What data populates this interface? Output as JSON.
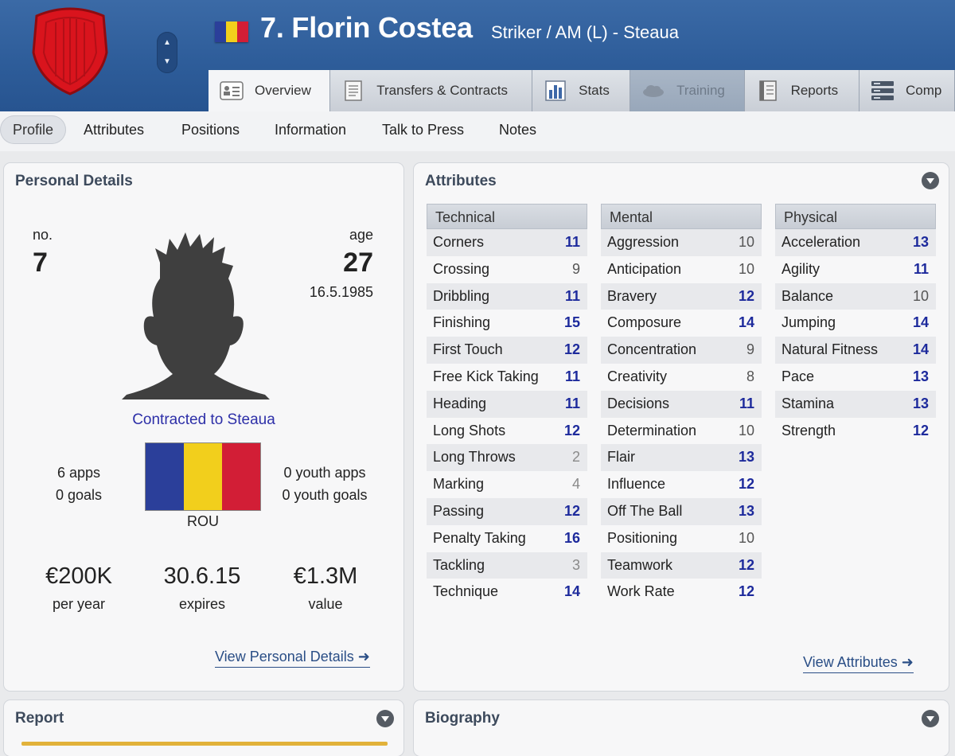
{
  "header": {
    "player_number_name": "7. Florin Costea",
    "subtitle": "Striker / AM (L) - Steaua",
    "flag_colors": [
      "#2b3f9a",
      "#f2cf1c",
      "#d21e36"
    ]
  },
  "main_tabs": [
    {
      "label": "Overview",
      "icon": "overview-icon",
      "state": "active"
    },
    {
      "label": "Transfers & Contracts",
      "icon": "document-icon",
      "state": "normal"
    },
    {
      "label": "Stats",
      "icon": "bar-chart-icon",
      "state": "normal"
    },
    {
      "label": "Training",
      "icon": "cloud-icon",
      "state": "disabled"
    },
    {
      "label": "Reports",
      "icon": "report-icon",
      "state": "normal"
    },
    {
      "label": "Comp",
      "icon": "compare-icon",
      "state": "normal"
    }
  ],
  "sub_nav": [
    "Profile",
    "Attributes",
    "Positions",
    "Information",
    "Talk to Press",
    "Notes"
  ],
  "personal_details": {
    "title": "Personal Details",
    "no_label": "no.",
    "no_value": "7",
    "age_label": "age",
    "age_value": "27",
    "dob": "16.5.1985",
    "contract_text": "Contracted to Steaua",
    "apps": "6 apps",
    "goals": "0 goals",
    "youth_apps": "0 youth apps",
    "youth_goals": "0 youth goals",
    "nation_code": "ROU",
    "wage_value": "€200K",
    "wage_label": "per year",
    "expires_value": "30.6.15",
    "expires_label": "expires",
    "value_value": "€1.3M",
    "value_label": "value",
    "view_link": "View Personal Details"
  },
  "attributes": {
    "title": "Attributes",
    "view_link": "View Attributes",
    "columns": [
      {
        "header": "Technical",
        "rows": [
          {
            "name": "Corners",
            "value": 11
          },
          {
            "name": "Crossing",
            "value": 9
          },
          {
            "name": "Dribbling",
            "value": 11
          },
          {
            "name": "Finishing",
            "value": 15
          },
          {
            "name": "First Touch",
            "value": 12
          },
          {
            "name": "Free Kick Taking",
            "value": 11
          },
          {
            "name": "Heading",
            "value": 11
          },
          {
            "name": "Long Shots",
            "value": 12
          },
          {
            "name": "Long Throws",
            "value": 2
          },
          {
            "name": "Marking",
            "value": 4
          },
          {
            "name": "Passing",
            "value": 12
          },
          {
            "name": "Penalty Taking",
            "value": 16
          },
          {
            "name": "Tackling",
            "value": 3
          },
          {
            "name": "Technique",
            "value": 14
          }
        ]
      },
      {
        "header": "Mental",
        "rows": [
          {
            "name": "Aggression",
            "value": 10
          },
          {
            "name": "Anticipation",
            "value": 10
          },
          {
            "name": "Bravery",
            "value": 12
          },
          {
            "name": "Composure",
            "value": 14
          },
          {
            "name": "Concentration",
            "value": 9
          },
          {
            "name": "Creativity",
            "value": 8
          },
          {
            "name": "Decisions",
            "value": 11
          },
          {
            "name": "Determination",
            "value": 10
          },
          {
            "name": "Flair",
            "value": 13
          },
          {
            "name": "Influence",
            "value": 12
          },
          {
            "name": "Off The Ball",
            "value": 13
          },
          {
            "name": "Positioning",
            "value": 10
          },
          {
            "name": "Teamwork",
            "value": 12
          },
          {
            "name": "Work Rate",
            "value": 12
          }
        ]
      },
      {
        "header": "Physical",
        "rows": [
          {
            "name": "Acceleration",
            "value": 13
          },
          {
            "name": "Agility",
            "value": 11
          },
          {
            "name": "Balance",
            "value": 10
          },
          {
            "name": "Jumping",
            "value": 14
          },
          {
            "name": "Natural Fitness",
            "value": 14
          },
          {
            "name": "Pace",
            "value": 13
          },
          {
            "name": "Stamina",
            "value": 13
          },
          {
            "name": "Strength",
            "value": 12
          }
        ]
      }
    ]
  },
  "report": {
    "title": "Report"
  },
  "biography": {
    "title": "Biography"
  }
}
